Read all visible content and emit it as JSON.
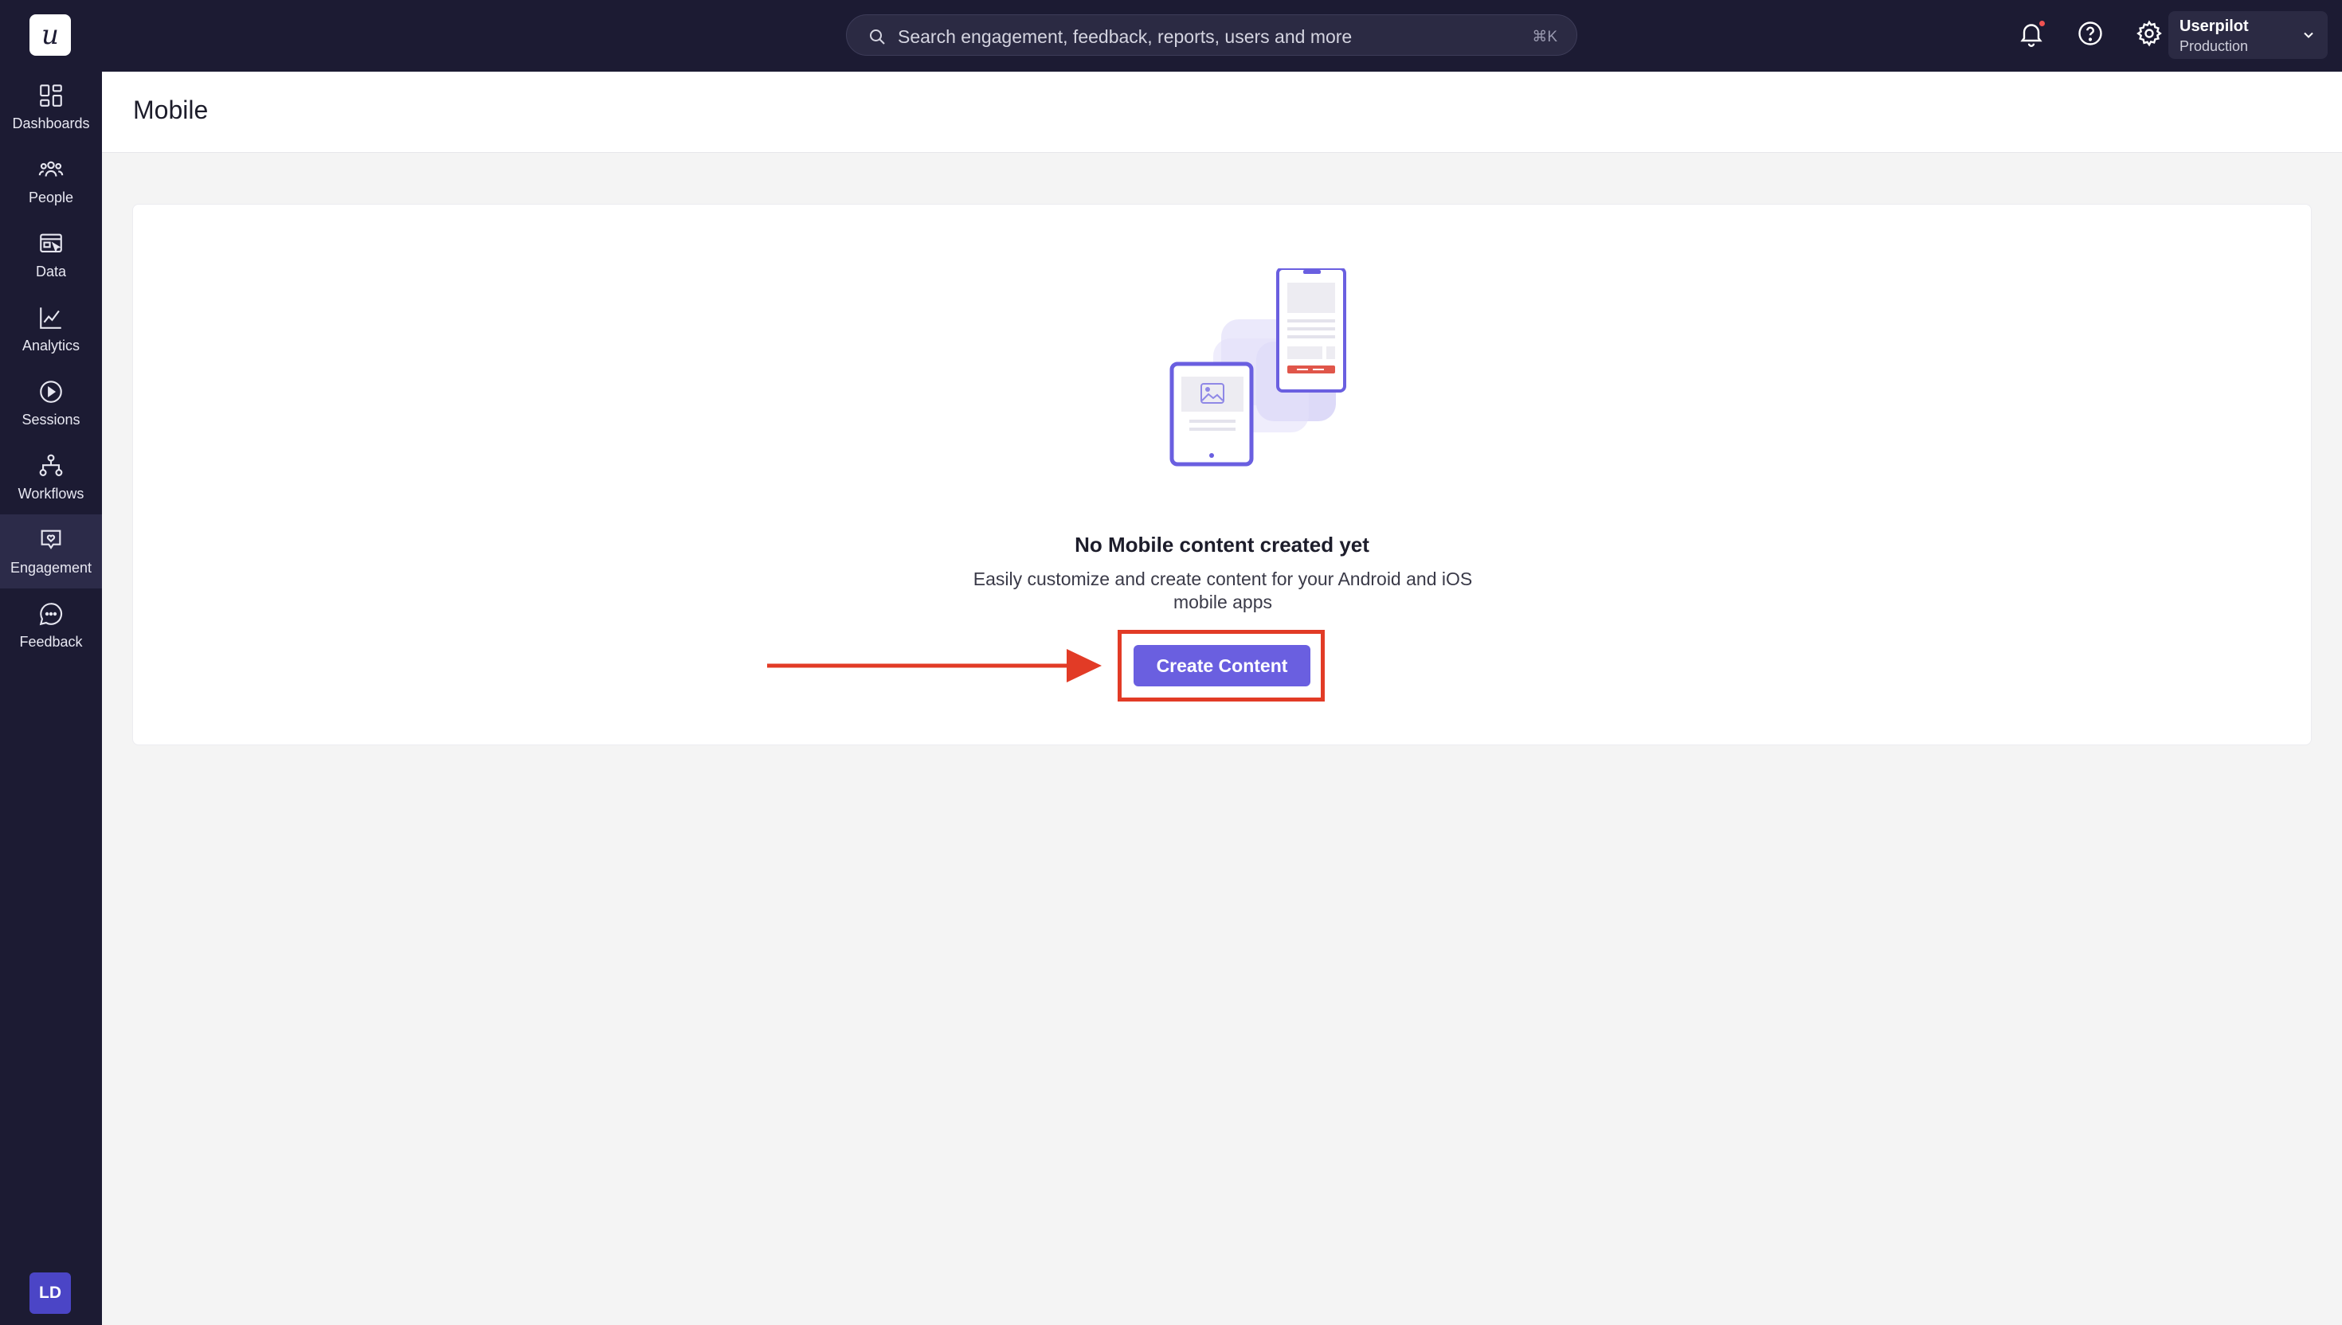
{
  "logo": {
    "glyph": "u",
    "name": "userpilot-logo"
  },
  "sidebar": {
    "items": [
      {
        "label": "Dashboards",
        "icon": "dashboard-icon"
      },
      {
        "label": "People",
        "icon": "people-icon"
      },
      {
        "label": "Data",
        "icon": "data-icon"
      },
      {
        "label": "Analytics",
        "icon": "analytics-icon"
      },
      {
        "label": "Sessions",
        "icon": "play-circle-icon"
      },
      {
        "label": "Workflows",
        "icon": "workflow-icon"
      },
      {
        "label": "Engagement",
        "icon": "engagement-icon",
        "active": true
      },
      {
        "label": "Feedback",
        "icon": "chat-bubble-icon"
      }
    ],
    "avatar_initials": "LD"
  },
  "topbar": {
    "search_placeholder": "Search engagement, feedback, reports, users and more",
    "search_shortcut": "⌘K",
    "workspace_name": "Userpilot",
    "workspace_env": "Production"
  },
  "page": {
    "title": "Mobile"
  },
  "empty_state": {
    "title": "No Mobile content created yet",
    "description": "Easily customize and create content for your Android and iOS mobile apps",
    "button_label": "Create Content"
  },
  "colors": {
    "sidebar_bg": "#1c1b33",
    "accent": "#6a5fe0",
    "highlight": "#e23b26",
    "notification": "#f05252"
  }
}
